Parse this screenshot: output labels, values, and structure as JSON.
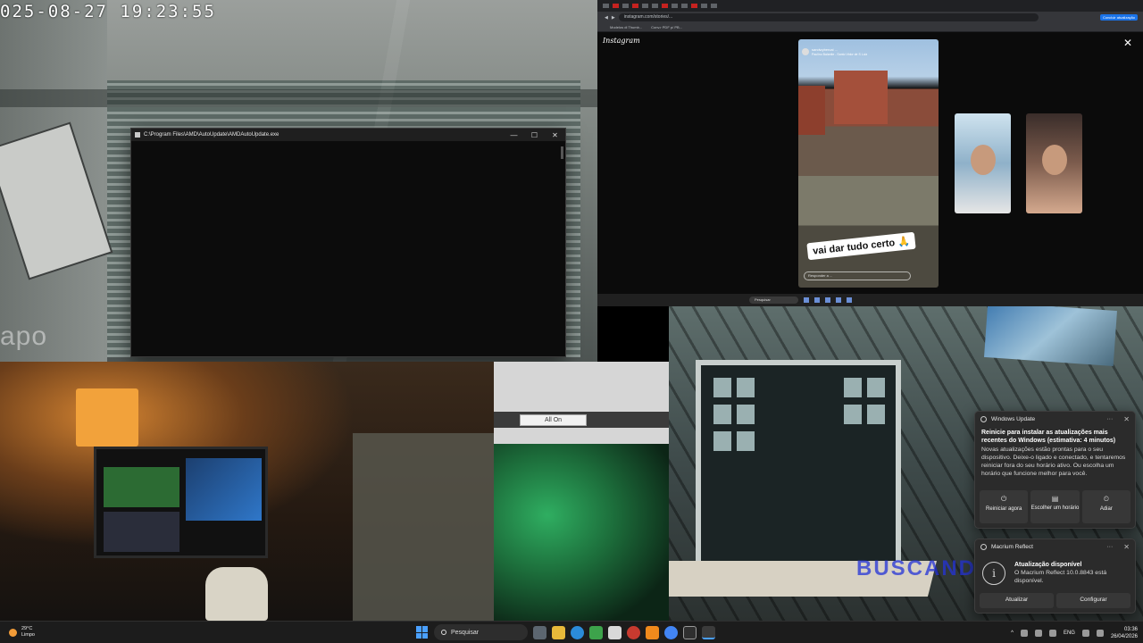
{
  "camera": {
    "timestamp": "025-08-27 19:23:55",
    "brand_watermark": "apo"
  },
  "amd_window": {
    "title": "C:\\Program Files\\AMD\\AutoUpdate\\AMDAutoUpdate.exe",
    "minimize_glyph": "—",
    "maximize_glyph": "☐",
    "close_glyph": "✕"
  },
  "instagram": {
    "logo": "Instagram",
    "close_glyph": "✕",
    "url": "instagram.com/stories/...",
    "bookmarks": [
      "Modelos di Thumb...",
      "Conv.r PDF p/ PB..."
    ],
    "story_user": "sandwybercai ...",
    "story_location": "Paulino Balanite - Santo Vidor de S Luiz",
    "sticker_text": "vai dar tudo certo 🙏",
    "reply_placeholder": "Responder a ...",
    "taskbar_search": "Pesquisar",
    "extension_button": "Concluir atualização"
  },
  "ui_snippet": {
    "all_on_label": "All On"
  },
  "wall_feed": {
    "neon_text": "BUSCANDO"
  },
  "notifications": {
    "windows_update": {
      "app": "Windows Update",
      "more": "···",
      "close": "✕",
      "title": "Reinicie para instalar as atualizações mais recentes do Windows (estimativa: 4 minutos)",
      "body": "Novas atualizações estão prontas para o seu dispositivo. Deixe-o ligado e conectado, e tentaremos reiniciar fora do seu horário ativo. Ou escolha um horário que funcione melhor para você.",
      "actions": [
        {
          "symbol": "⏻",
          "label": "Reiniciar agora"
        },
        {
          "symbol": "▤",
          "label": "Escolher um horário"
        },
        {
          "symbol": "⏲",
          "label": "Adiar"
        }
      ]
    },
    "macrium": {
      "app": "Macrium Reflect",
      "more": "···",
      "close": "✕",
      "info_symbol": "i",
      "title": "Atualização disponível",
      "body": "O Macrium Reflect 10.0.8843 está disponível.",
      "actions": [
        {
          "label": "Atualizar"
        },
        {
          "label": "Configurar"
        }
      ]
    }
  },
  "taskbar": {
    "temperature": "29°C",
    "condition": "Limpo",
    "search_placeholder": "Pesquisar",
    "language": "ENG",
    "time": "03:36",
    "date": "26/04/2026",
    "tray_chevron": "^"
  },
  "colors": {
    "accent": "#4aa0ff",
    "toast_bg": "#2b2b2b",
    "taskbar_bg": "#1c1c1c"
  }
}
